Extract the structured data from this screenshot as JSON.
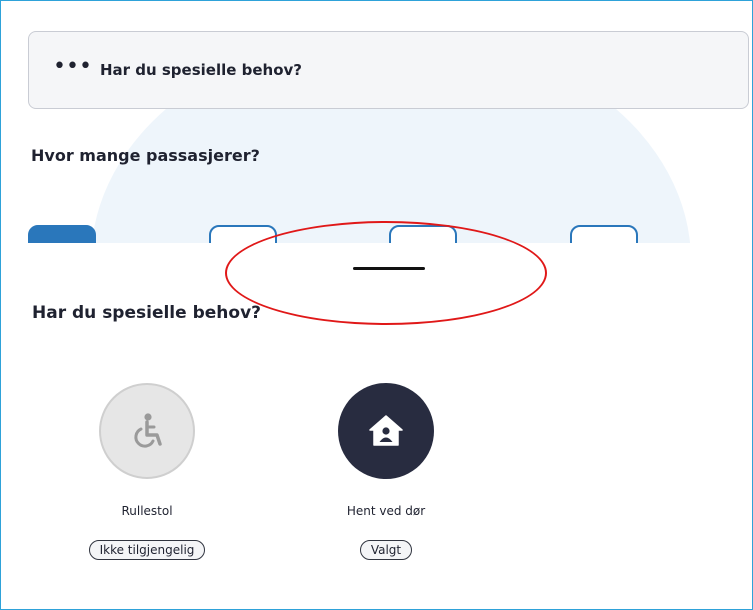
{
  "info_card": {
    "dots": "•••",
    "text": "Har du spesielle behov?"
  },
  "passengers": {
    "label": "Hvor mange passasjerer?"
  },
  "sheet": {
    "title": "Har du spesielle behov?",
    "options": [
      {
        "label": "Rullestol",
        "status": "Ikke tilgjengelig",
        "icon": "wheelchair-icon"
      },
      {
        "label": "Hent ved dør",
        "status": "Valgt",
        "icon": "home-person-icon"
      }
    ]
  },
  "colors": {
    "frame_border": "#2ea2d9",
    "accent_blue": "#2a77bb",
    "annotation_red": "#e01818",
    "active_circle": "#282c40",
    "disabled_circle": "#e6e6e6"
  }
}
